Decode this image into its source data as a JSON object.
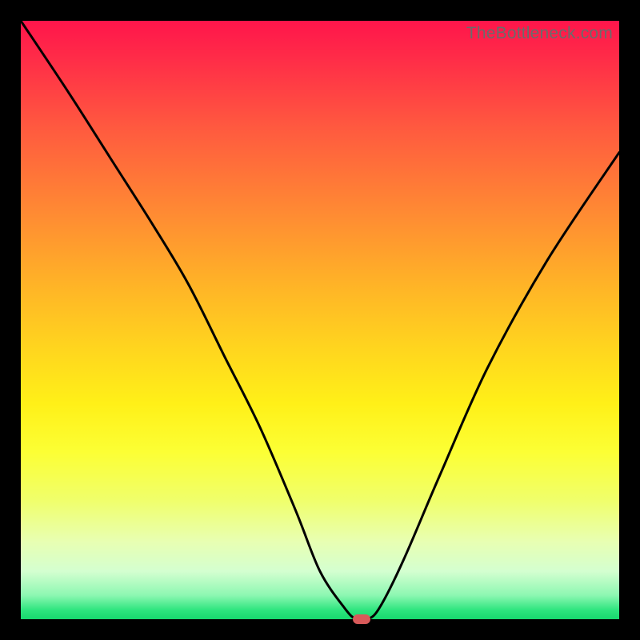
{
  "watermark": "TheBottleneck.com",
  "colors": {
    "accent_marker": "#d85a5a",
    "curve": "#000000"
  },
  "chart_data": {
    "type": "line",
    "title": "",
    "xlabel": "",
    "ylabel": "",
    "xlim": [
      0,
      100
    ],
    "ylim": [
      0,
      100
    ],
    "grid": false,
    "legend": false,
    "series": [
      {
        "name": "bottleneck-curve",
        "x": [
          0,
          8,
          15,
          22,
          28,
          34,
          40,
          46,
          50,
          54,
          56,
          58,
          60,
          64,
          70,
          78,
          88,
          100
        ],
        "values": [
          100,
          88,
          77,
          66,
          56,
          44,
          32,
          18,
          8,
          2,
          0,
          0,
          2,
          10,
          24,
          42,
          60,
          78
        ]
      }
    ],
    "marker": {
      "x": 57,
      "y": 0
    }
  }
}
